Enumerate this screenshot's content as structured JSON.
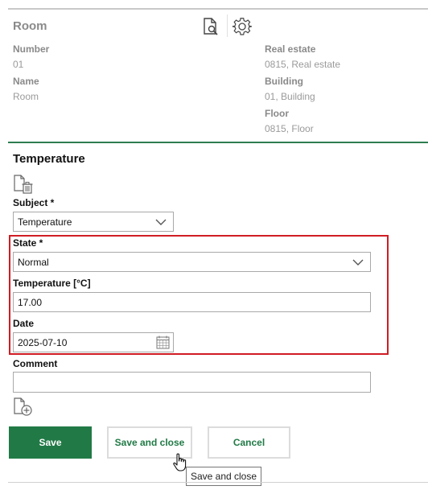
{
  "header": {
    "title": "Room"
  },
  "info": {
    "left": [
      {
        "label": "Number",
        "value": "01"
      },
      {
        "label": "Name",
        "value": "Room"
      }
    ],
    "right": [
      {
        "label": "Real estate",
        "value": "0815, Real estate"
      },
      {
        "label": "Building",
        "value": "01, Building"
      },
      {
        "label": "Floor",
        "value": "0815, Floor"
      }
    ]
  },
  "form": {
    "section_title": "Temperature",
    "subject": {
      "label": "Subject *",
      "value": "Temperature"
    },
    "state": {
      "label": "State *",
      "value": "Normal"
    },
    "temperature": {
      "label": "Temperature [°C]",
      "value": "17.00"
    },
    "date": {
      "label": "Date",
      "value": "2025-07-10"
    },
    "comment": {
      "label": "Comment",
      "value": ""
    }
  },
  "buttons": {
    "save": "Save",
    "save_close": "Save and close",
    "cancel": "Cancel"
  },
  "tooltip": "Save and close",
  "colors": {
    "primary": "#217a46",
    "divider": "#2e7d4f",
    "highlight": "#d01c24"
  }
}
